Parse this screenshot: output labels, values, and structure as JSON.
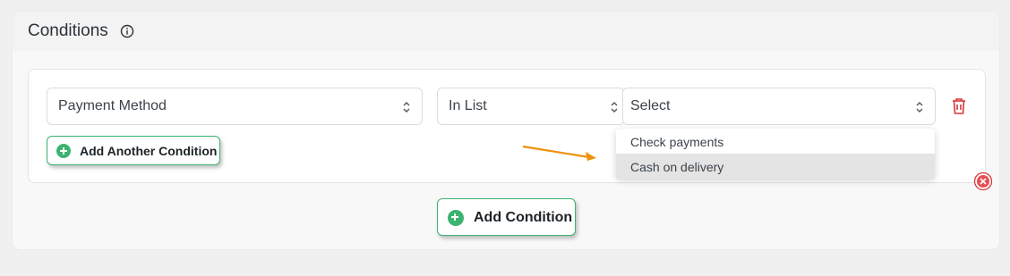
{
  "panel": {
    "title": "Conditions",
    "info_icon": "info-icon"
  },
  "condition": {
    "field_value": "Payment Method",
    "operator_value": "In List",
    "values_placeholder": "Select"
  },
  "buttons": {
    "add_another": "Add Another Condition",
    "add_condition": "Add Condition"
  },
  "dropdown": {
    "options": [
      "Check payments",
      "Cash on delivery"
    ],
    "highlighted": "Cash on delivery"
  },
  "icons": {
    "delete": "trash-icon",
    "remove": "close-circle-icon",
    "arrow": "annotation-arrow"
  },
  "colors": {
    "accent_green": "#3cb371",
    "delete_red": "#d63638",
    "arrow_orange": "#f0900a"
  }
}
